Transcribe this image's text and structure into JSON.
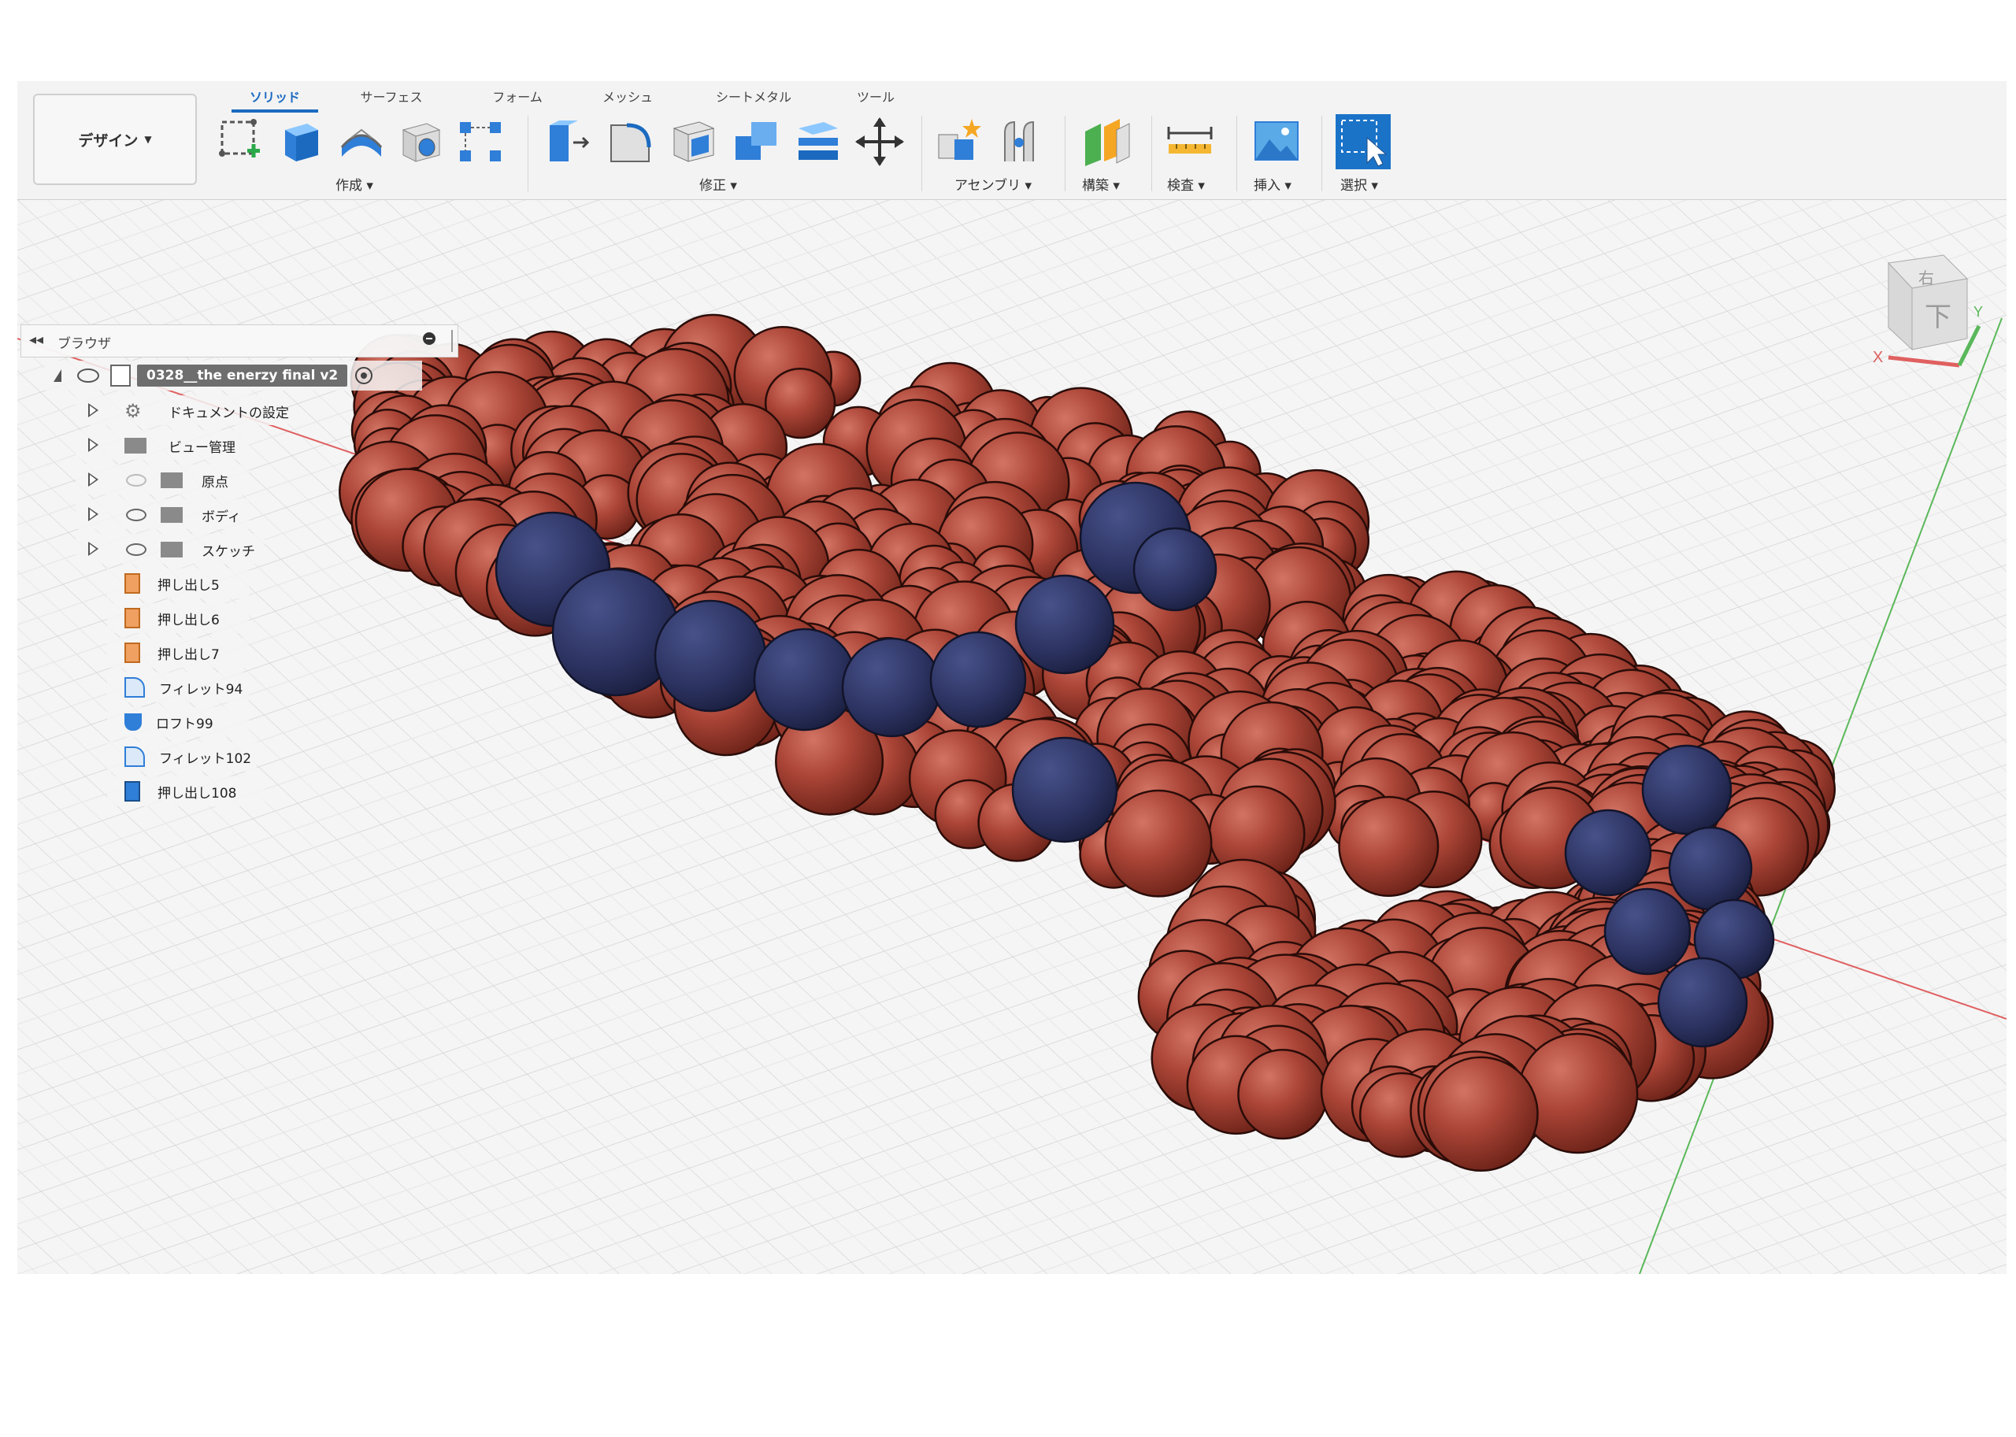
{
  "toolbar": {
    "workspace": "デザイン",
    "tabs": [
      "ソリッド",
      "サーフェス",
      "フォーム",
      "メッシュ",
      "シートメタル",
      "ツール"
    ],
    "active_tab": 0,
    "groups": [
      "作成",
      "修正",
      "アセンブリ",
      "構築",
      "検査",
      "挿入",
      "選択"
    ]
  },
  "browser": {
    "title": "ブラウザ",
    "root": "0328__the enerzy final v2",
    "folders": [
      "ドキュメントの設定",
      "ビュー管理",
      "原点",
      "ボディ",
      "スケッチ"
    ],
    "features": [
      "押し出し5",
      "押し出し6",
      "押し出し7",
      "フィレット94",
      "ロフト99",
      "フィレット102",
      "押し出し108"
    ]
  },
  "viewcube": {
    "face": "下",
    "top_face": "右",
    "axis_x": "X",
    "axis_y": "Y"
  },
  "colors": {
    "accent": "#1b6ac0",
    "body_red": "#a8443a",
    "body_blue": "#2e3564",
    "grid": "#d6d6d6",
    "axis_red": "#e06060",
    "axis_green": "#5ab85a"
  }
}
